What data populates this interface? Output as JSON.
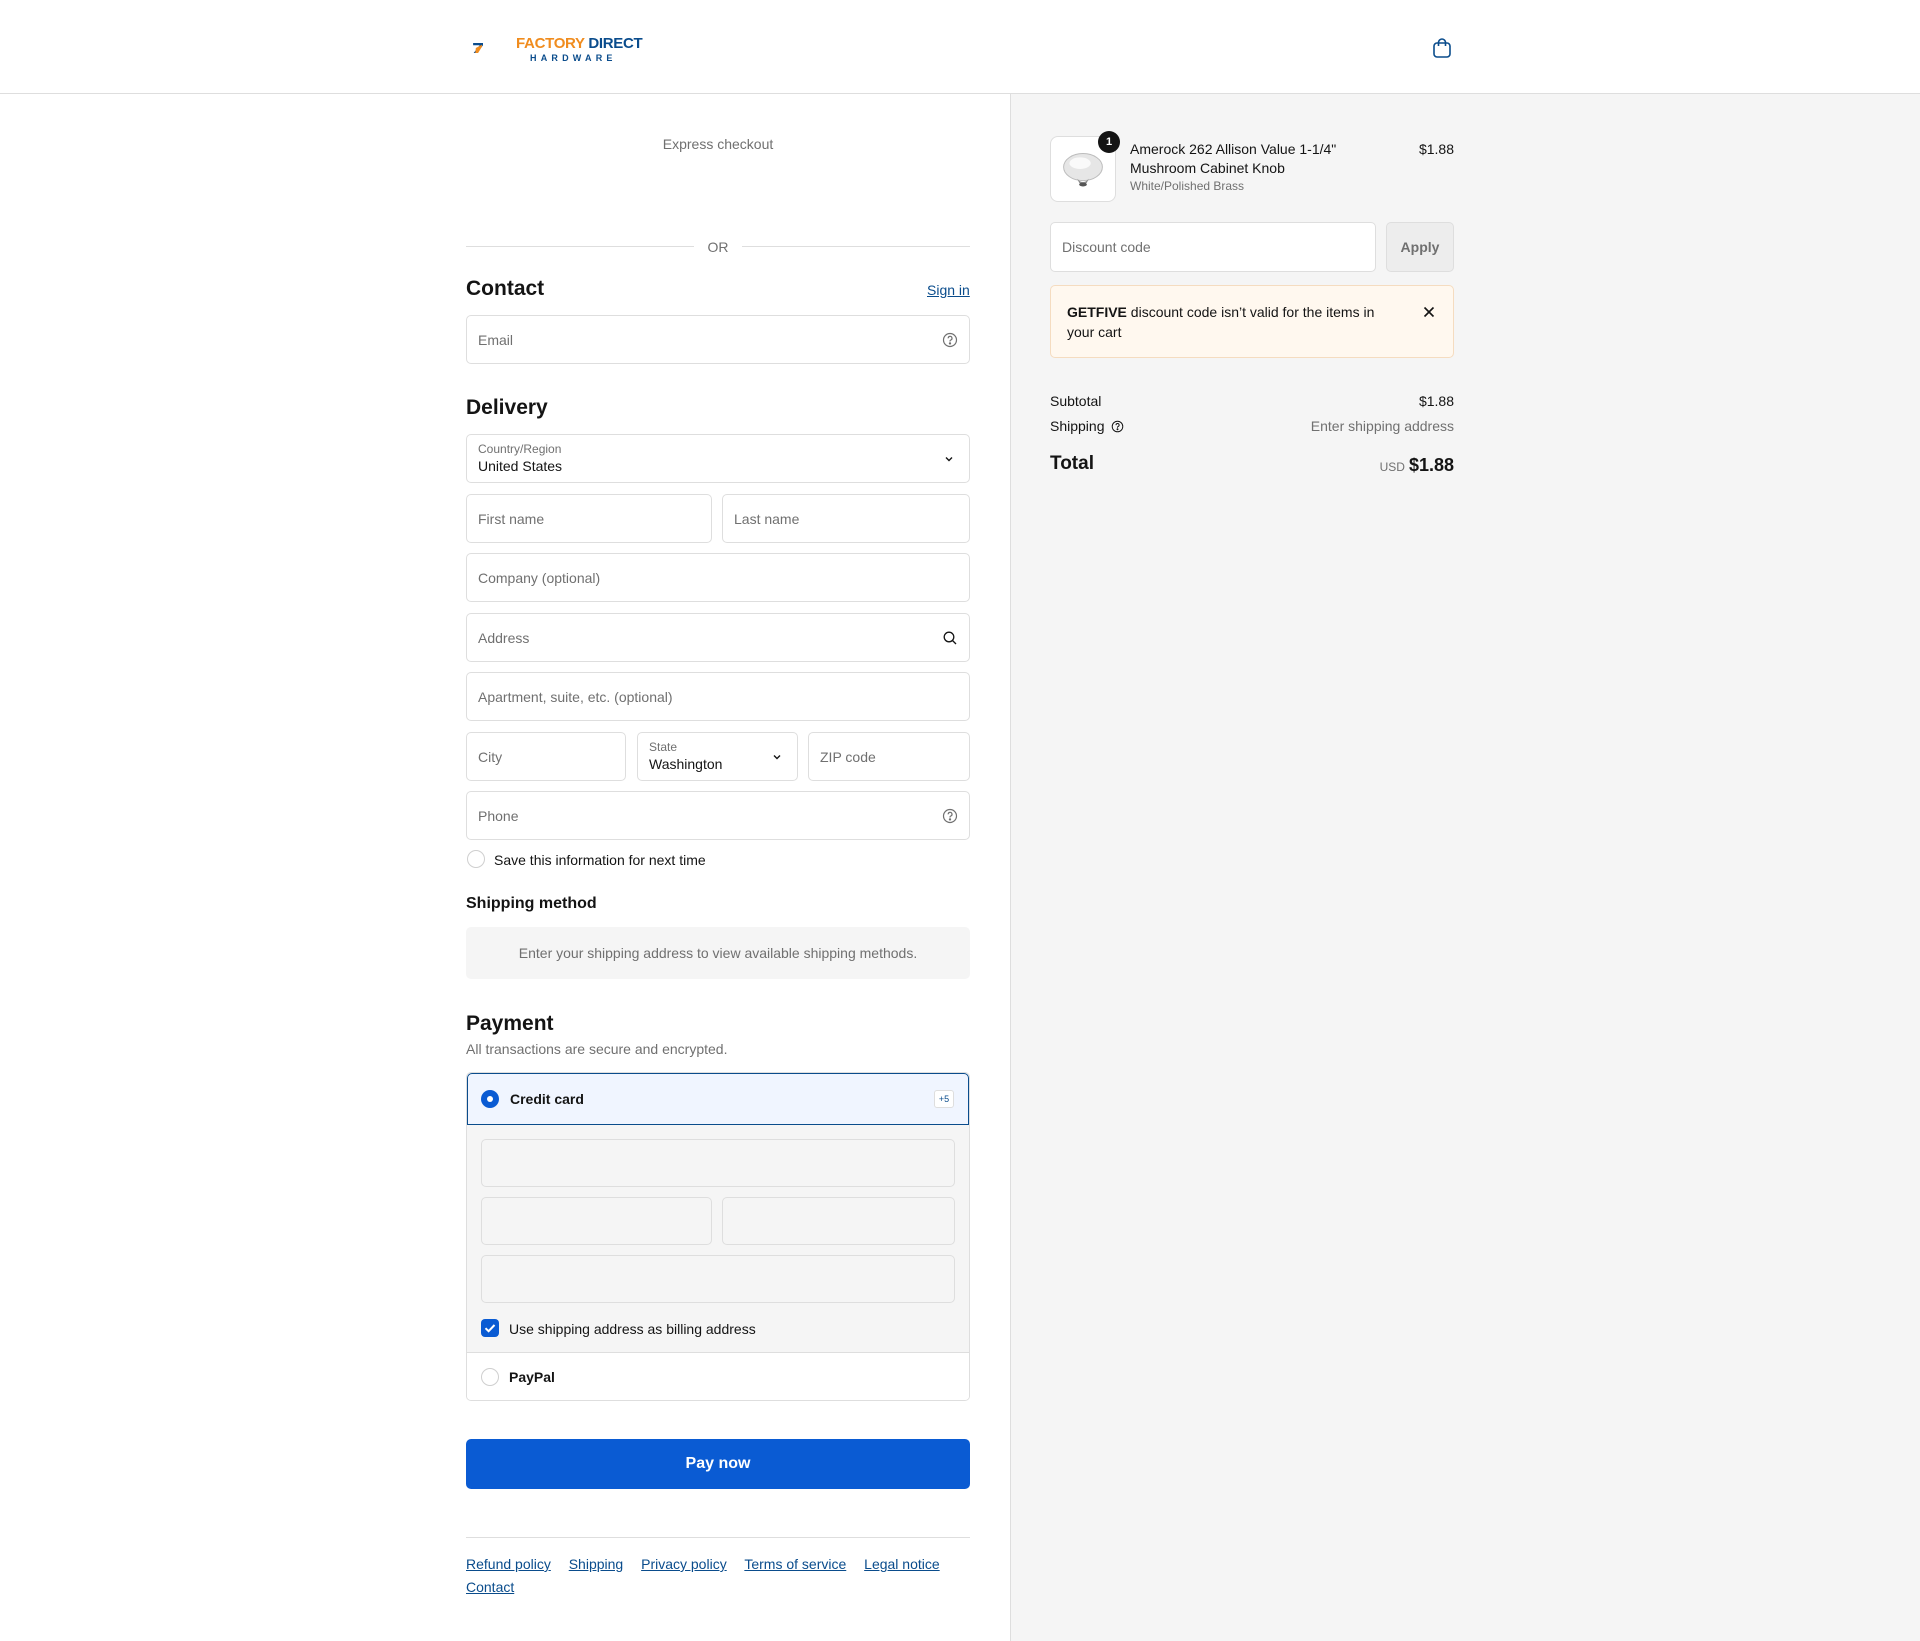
{
  "brand": {
    "logo_line1_a": "FACTORY",
    "logo_line1_b": "DIRECT",
    "logo_line2": "HARDWARE"
  },
  "header": {
    "cart_icon": "shopping-bag-icon"
  },
  "express": {
    "label": "Express checkout",
    "or": "OR"
  },
  "contact": {
    "title": "Contact",
    "sign_in": "Sign in",
    "email_placeholder": "Email"
  },
  "delivery": {
    "title": "Delivery",
    "country_label": "Country/Region",
    "country_value": "United States",
    "first_name_placeholder": "First name",
    "last_name_placeholder": "Last name",
    "company_placeholder": "Company (optional)",
    "address_placeholder": "Address",
    "apartment_placeholder": "Apartment, suite, etc. (optional)",
    "city_placeholder": "City",
    "state_label": "State",
    "state_value": "Washington",
    "zip_placeholder": "ZIP code",
    "phone_placeholder": "Phone",
    "save_info": "Save this information for next time"
  },
  "shipping_method": {
    "title": "Shipping method",
    "message": "Enter your shipping address to view available shipping methods."
  },
  "payment": {
    "title": "Payment",
    "subtitle": "All transactions are secure and encrypted.",
    "credit_card": "Credit card",
    "more_cards": "+5",
    "billing_same": "Use shipping address as billing address",
    "paypal": "PayPal",
    "pay_now": "Pay now"
  },
  "footer": {
    "links": [
      "Refund policy",
      "Shipping",
      "Privacy policy",
      "Terms of service",
      "Legal notice",
      "Contact"
    ]
  },
  "cart": {
    "item": {
      "quantity": "1",
      "name": "Amerock 262 Allison Value 1-1/4\" Mushroom Cabinet Knob",
      "variant": "White/Polished Brass",
      "price": "$1.88"
    },
    "discount_placeholder": "Discount code",
    "apply": "Apply",
    "alert_code": "GETFIVE",
    "alert_message": " discount code isn’t valid for the items in your cart",
    "subtotal_label": "Subtotal",
    "subtotal_value": "$1.88",
    "shipping_label": "Shipping",
    "shipping_value": "Enter shipping address",
    "total_label": "Total",
    "currency": "USD",
    "total_value": "$1.88"
  },
  "colors": {
    "accent": "#0a5bd3",
    "link": "#0a4c8c",
    "logo_orange": "#f08c1e",
    "logo_blue": "#0a4c8c"
  }
}
